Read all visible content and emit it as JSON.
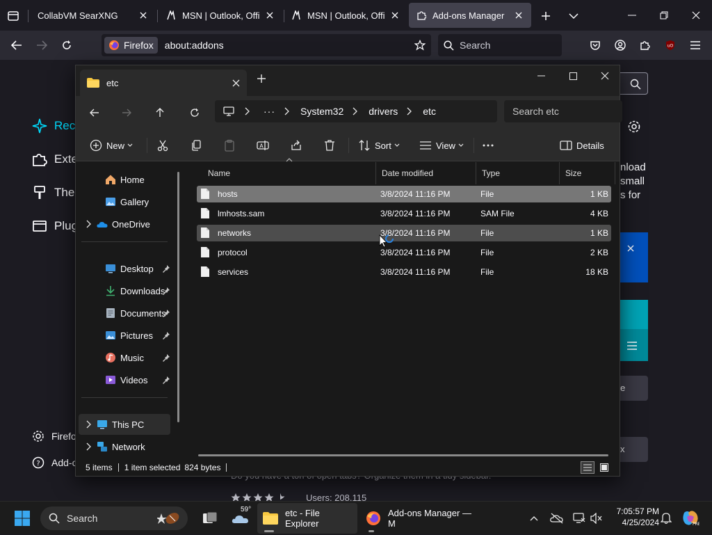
{
  "firefox": {
    "tabs": [
      {
        "title": "CollabVM SearXNG",
        "active": false
      },
      {
        "title": "MSN | Outlook, Office, Skype, Bing, Breaking News, and Latest Videos",
        "active": false
      },
      {
        "title": "MSN | Outlook, Office, Skype, Bing, Breaking News, and Latest Videos",
        "active": false
      },
      {
        "title": "Add-ons Manager",
        "active": true
      }
    ],
    "identity_label": "Firefox",
    "url": "about:addons",
    "search_placeholder": "Search"
  },
  "addons": {
    "categories": [
      {
        "label": "Recommendations",
        "selected": true
      },
      {
        "label": "Extensions"
      },
      {
        "label": "Themes"
      },
      {
        "label": "Plugins"
      }
    ],
    "footer": [
      {
        "label": "Firefox Settings"
      },
      {
        "label": "Add-ons Support"
      }
    ],
    "recommendation_text": [
      "nload",
      "small",
      "s for"
    ],
    "promo_text": "Do you have a ton of open tabs? Organize them in a tidy sidebar.",
    "users_label": "Users: 208,115",
    "rating": 4.5,
    "button_partial_1": "e",
    "button_partial_2": "x"
  },
  "explorer": {
    "tab_title": "etc",
    "breadcrumb": [
      "System32",
      "drivers",
      "etc"
    ],
    "search_placeholder": "Search etc",
    "commands": {
      "new": "New",
      "sort": "Sort",
      "view": "View",
      "details": "Details"
    },
    "nav": {
      "home": "Home",
      "gallery": "Gallery",
      "onedrive": "OneDrive",
      "desktop": "Desktop",
      "downloads": "Downloads",
      "documents": "Documents",
      "pictures": "Pictures",
      "music": "Music",
      "videos": "Videos",
      "this_pc": "This PC",
      "network": "Network"
    },
    "columns": {
      "name": "Name",
      "date": "Date modified",
      "type": "Type",
      "size": "Size"
    },
    "files": [
      {
        "name": "hosts",
        "date": "3/8/2024 11:16 PM",
        "type": "File",
        "size": "1 KB",
        "state": "selected"
      },
      {
        "name": "lmhosts.sam",
        "date": "3/8/2024 11:16 PM",
        "type": "SAM File",
        "size": "4 KB",
        "state": ""
      },
      {
        "name": "networks",
        "date": "3/8/2024 11:16 PM",
        "type": "File",
        "size": "1 KB",
        "state": "hover"
      },
      {
        "name": "protocol",
        "date": "3/8/2024 11:16 PM",
        "type": "File",
        "size": "2 KB",
        "state": ""
      },
      {
        "name": "services",
        "date": "3/8/2024 11:16 PM",
        "type": "File",
        "size": "18 KB",
        "state": ""
      }
    ],
    "status": {
      "items": "5 items",
      "selected": "1 item selected",
      "bytes": "824 bytes"
    }
  },
  "taskbar": {
    "search_placeholder": "Search",
    "weather_temp": "59°",
    "apps": [
      {
        "label": "etc - File Explorer",
        "active": true
      },
      {
        "label": "Add-ons Manager — M",
        "active": false
      }
    ],
    "time": "7:05:57 PM",
    "date": "4/25/2024"
  }
}
